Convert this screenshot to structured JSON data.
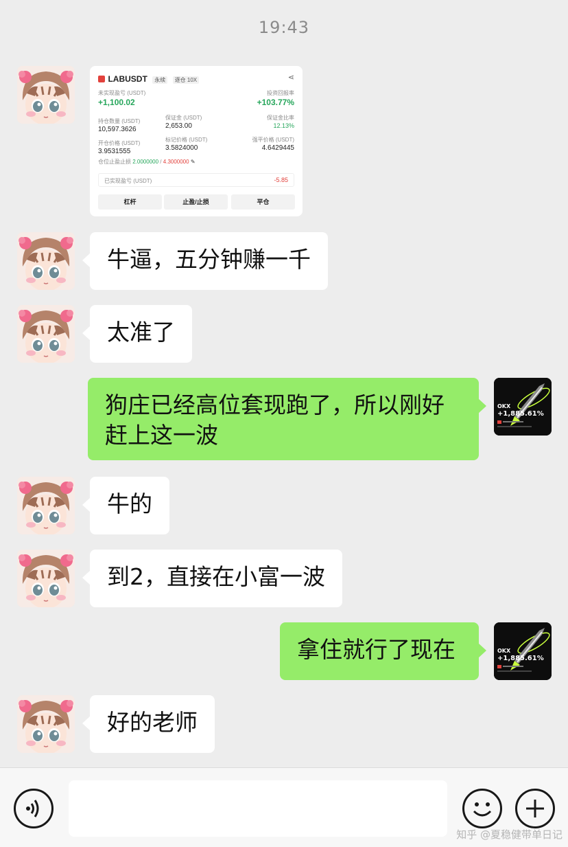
{
  "status_time": "19:43",
  "card": {
    "symbol": "LABUSDT",
    "tag_perp": "永续",
    "tag_margin": "逐仓 10X",
    "unrealized_label": "未实现盈亏 (USDT)",
    "unrealized_value": "+1,100.02",
    "roi_label": "投资回报率",
    "roi_value": "+103.77%",
    "position_label": "持仓数量 (USDT)",
    "position_value": "10,597.3626",
    "margin_label": "保证金 (USDT)",
    "margin_value": "2,653.00",
    "margin_ratio_label": "保证金比率",
    "margin_ratio_value": "12.13%",
    "entry_label": "开仓价格 (USDT)",
    "entry_value": "3.9531555",
    "mark_label": "标记价格 (USDT)",
    "mark_value": "3.5824000",
    "liq_label": "强平价格 (USDT)",
    "liq_value": "4.6429445",
    "tpsl_label": "仓位止盈止损",
    "tp_value": "2.0000000",
    "sl_value": "4.3000000",
    "realized_label": "已实现盈亏 (USDT)",
    "realized_value": "-5.85",
    "btn_leverage": "杠杆",
    "btn_tpsl": "止盈/止损",
    "btn_close": "平仓"
  },
  "messages": [
    {
      "side": "in",
      "text": "牛逼，五分钟赚一千"
    },
    {
      "side": "in",
      "text": "太准了"
    },
    {
      "side": "out",
      "text": "狗庄已经高位套现跑了，所以刚好赶上这一波"
    },
    {
      "side": "in",
      "text": "牛的"
    },
    {
      "side": "in",
      "text": "到2，直接在小富一波"
    },
    {
      "side": "out",
      "text": "拿住就行了现在"
    },
    {
      "side": "in",
      "text": "好的老师"
    }
  ],
  "self_avatar": {
    "brand": "OKX",
    "percent": "+1,885.61%"
  },
  "watermark": "知乎 @夏稳健带单日记",
  "colors": {
    "out_bubble": "#95ec69",
    "in_bubble": "#ffffff",
    "background": "#ededed"
  }
}
